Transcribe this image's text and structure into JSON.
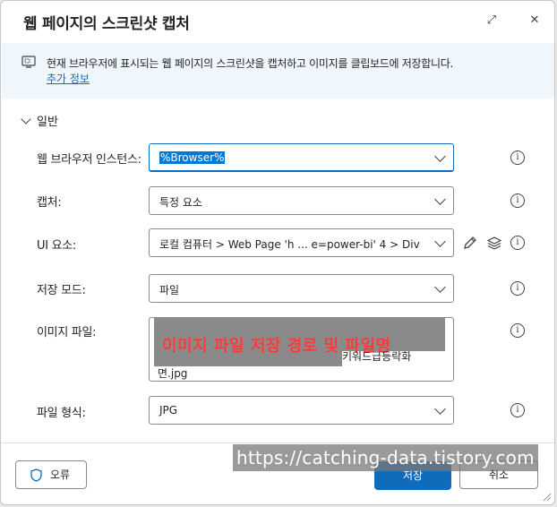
{
  "dialog": {
    "title": "웹 페이지의 스크린샷 캡처",
    "expand_icon": "⤢",
    "close_icon": "✕"
  },
  "banner": {
    "text": "현재 브라우저에 표시되는 웹 페이지의 스크린샷을 캡처하고 이미지를 클립보드에 저장합니다.",
    "link": "추가 정보"
  },
  "section": {
    "label": "일반"
  },
  "fields": {
    "browser_instance": {
      "label": "웹 브라우저 인스턴스:",
      "value": "%Browser%"
    },
    "capture": {
      "label": "캡처:",
      "value": "특정 요소"
    },
    "ui_element": {
      "label": "UI 요소:",
      "value": "로컬 컴퓨터 > Web Page 'h ... e=power-bi' 4 > Div"
    },
    "save_mode": {
      "label": "저장 모드:",
      "value": "파일"
    },
    "image_file": {
      "label": "이미지 파일:",
      "redaction_note": "이미지 파일 저장 경로 및 파일명",
      "visible_tail": "키워드급등락화",
      "visible_line2": "면.jpg"
    },
    "file_format": {
      "label": "파일 형식:",
      "value": "JPG"
    }
  },
  "footer": {
    "error_label": "오류",
    "save_label": "저장",
    "cancel_label": "취소"
  },
  "watermark": "https://catching-data.tistory.com",
  "colors": {
    "accent": "#0f6cbd",
    "banner_bg": "#eff6fc",
    "redaction": "#8a8a8a",
    "overlay_text": "#ff3b3b"
  }
}
